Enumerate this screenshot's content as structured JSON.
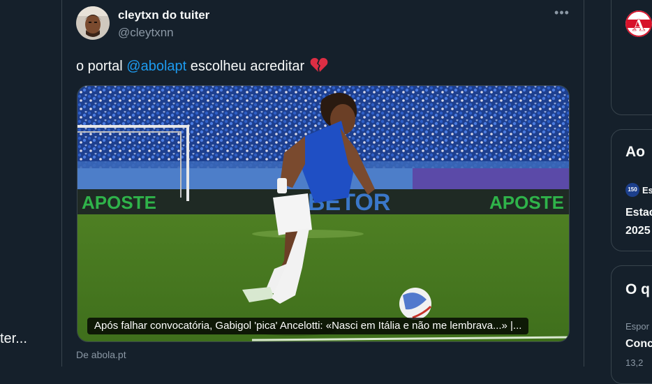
{
  "left": {
    "truncated_text": "ter..."
  },
  "tweet": {
    "display_name": "cleytxn do tuiter",
    "handle": "@cleytxnn",
    "more_icon": "more-horizontal-icon",
    "text_before": "o portal ",
    "mention": "@abolapt",
    "text_after": " escolheu acreditar ",
    "emoji_icon": "broken-heart-icon",
    "card": {
      "caption": "Após falhar convocatória, Gabigol 'pica' Ancelotti: «Nasci em Itália e não me lembrava...» |...",
      "source": "De abola.pt",
      "board_text_1": "APOSTE",
      "board_text_2": "BETOR",
      "board_text_3": "APOSTE"
    }
  },
  "right": {
    "logo_letter": "A",
    "box2_title": "Ao",
    "box2_badge": "150",
    "box2_source": "Es",
    "box2_line1": "Estac",
    "box2_line2": "2025",
    "box3_title": "O q",
    "box3_category": "Espor",
    "box3_headline": "Conc",
    "box3_meta": "13,2"
  },
  "colors": {
    "background": "#15202b",
    "link": "#1d9bf0",
    "secondary": "#8b98a5",
    "border": "#38444d"
  }
}
